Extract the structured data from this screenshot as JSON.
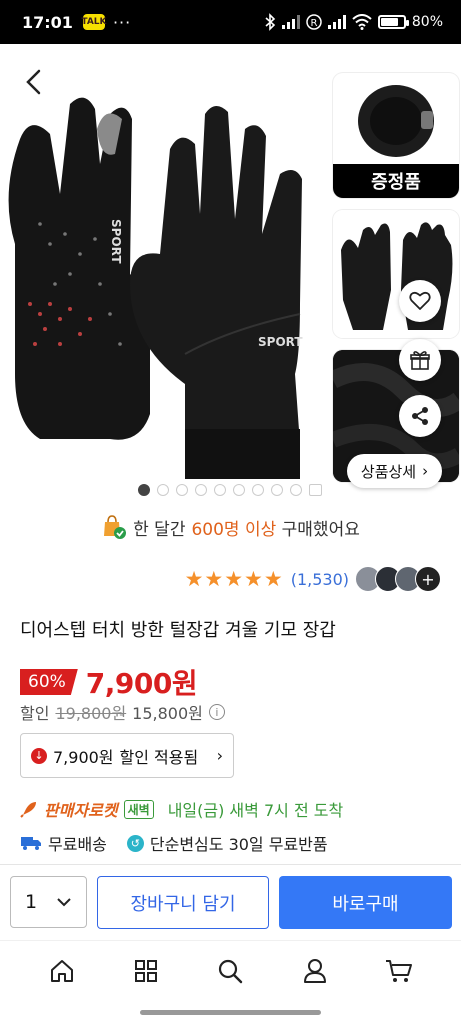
{
  "status_bar": {
    "time": "17:01",
    "kakao": "TALK",
    "dots": "···",
    "battery_pct": "80%",
    "battery_level": 0.8
  },
  "gallery": {
    "main_image_text": "SPORT",
    "thumb1_banner": "증정품",
    "detail_button": "상품상세",
    "pager_count": 9,
    "pager_active": 0
  },
  "purchase_note": {
    "prefix": "한 달간",
    "highlight": "600명 이상",
    "suffix": "구매했어요"
  },
  "rating": {
    "stars": 5,
    "count": "(1,530)"
  },
  "product": {
    "title": "디어스텝 터치 방한 털장갑 겨울 기모 장갑"
  },
  "price": {
    "discount": "60%",
    "final": "7,900원",
    "sub_label": "할인",
    "original": "19,800원",
    "sale": "15,800원"
  },
  "coupon": {
    "price": "7,900원",
    "label": "할인 적용됨"
  },
  "delivery": {
    "rocket": "판매자로켓",
    "badge": "새벽",
    "eta": "내일(금) 새벽 7시 전 도착",
    "shipping": "무료배송",
    "returns": "단순변심도 30일 무료반품"
  },
  "actions": {
    "qty": "1",
    "cart": "장바구니 담기",
    "buy": "바로구매"
  },
  "colors": {
    "accent": "#3478f6",
    "price": "#d81f1f",
    "rating": "#f5902b",
    "rocket": "#e0621c",
    "dawn": "#3a9a3a"
  },
  "nav_icons": [
    "home-icon",
    "category-icon",
    "search-icon",
    "user-icon",
    "cart-icon"
  ]
}
